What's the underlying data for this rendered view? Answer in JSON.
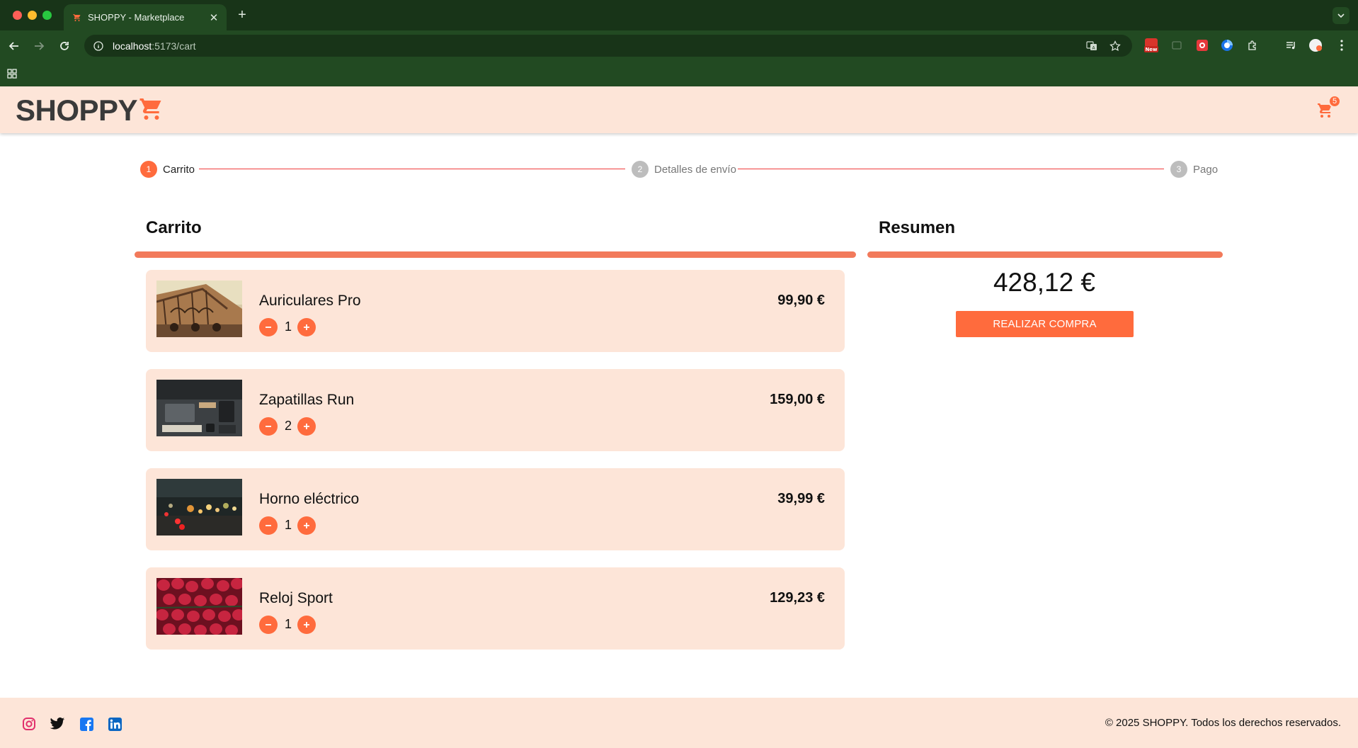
{
  "browser": {
    "tab_title": "SHOPPY - Marketplace",
    "url_host": "localhost",
    "url_path": ":5173/cart",
    "extension_badge": "New"
  },
  "header": {
    "logo_text": "SHOPPY",
    "cart_count": "5"
  },
  "stepper": {
    "steps": [
      {
        "number": "1",
        "label": "Carrito",
        "active": true
      },
      {
        "number": "2",
        "label": "Detalles de envío",
        "active": false
      },
      {
        "number": "3",
        "label": "Pago",
        "active": false
      }
    ]
  },
  "cart": {
    "title": "Carrito",
    "items": [
      {
        "name": "Auriculares Pro",
        "quantity": "1",
        "price": "99,90 €"
      },
      {
        "name": "Zapatillas Run",
        "quantity": "2",
        "price": "159,00 €"
      },
      {
        "name": "Horno eléctrico",
        "quantity": "1",
        "price": "39,99 €"
      },
      {
        "name": "Reloj Sport",
        "quantity": "1",
        "price": "129,23 €"
      }
    ]
  },
  "summary": {
    "title": "Resumen",
    "total": "428,12 €",
    "buy_label": "REALIZAR COMPRA"
  },
  "footer": {
    "copyright": "© 2025 SHOPPY. Todos los derechos reservados.",
    "social": [
      "instagram-icon",
      "twitter-icon",
      "facebook-icon",
      "linkedin-icon"
    ]
  },
  "colors": {
    "accent": "#ff6b3d",
    "header_bg": "#fde5d8",
    "chrome_bg": "#224a22"
  }
}
